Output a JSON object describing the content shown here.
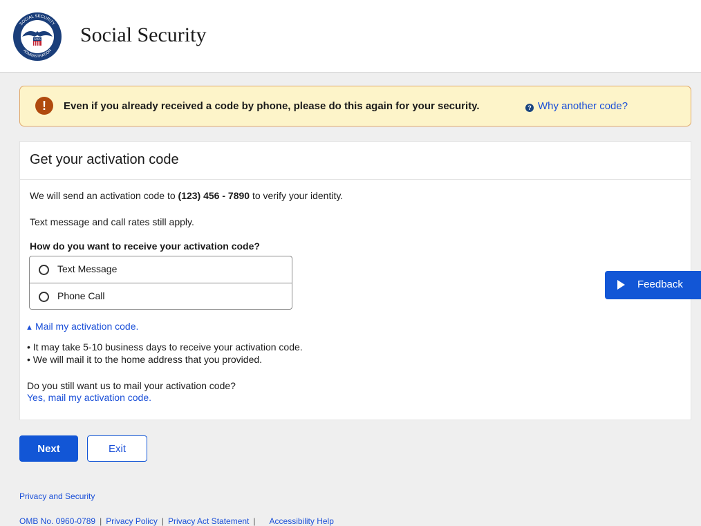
{
  "header": {
    "brand": "Social Security",
    "seal": {
      "top_text": "SOCIAL SECURITY",
      "bottom_text": "ADMINISTRATION",
      "shield_text": "USA"
    }
  },
  "alert": {
    "icon": "exclamation-icon",
    "message": "Even if you already received a code by phone, please do this again for your security.",
    "help_link": "Why another code?"
  },
  "card": {
    "title": "Get your activation code",
    "send_prefix": "We will send an activation code to ",
    "phone": "(123) 456 - 7890",
    "send_suffix": " to verify your identity.",
    "rates": "Text message and call rates still apply.",
    "question": "How do you want to receive your activation code?",
    "options": [
      {
        "label": "Text Message",
        "selected": false
      },
      {
        "label": "Phone Call",
        "selected": false
      }
    ],
    "mail": {
      "toggle_label": "Mail my activation code.",
      "bullets": [
        "• It may take 5-10 business days to receive your activation code.",
        "• We will mail it to the home address that you provided."
      ],
      "question": "Do you still want us to mail your activation code?",
      "confirm_link": "Yes, mail my activation code."
    }
  },
  "feedback": {
    "label": "Feedback"
  },
  "actions": {
    "next": "Next",
    "exit": "Exit"
  },
  "footer": {
    "privacy": "Privacy and Security",
    "links": [
      "OMB No. 0960-0789",
      "Privacy Policy",
      "Privacy Act Statement",
      "Accessibility Help"
    ],
    "separator": "|"
  },
  "colors": {
    "brand_blue": "#1256d6",
    "link_blue": "#1a4fd8",
    "alert_bg": "#fdf4c9",
    "alert_border": "#e0a86a",
    "alert_icon": "#b04a0e"
  }
}
